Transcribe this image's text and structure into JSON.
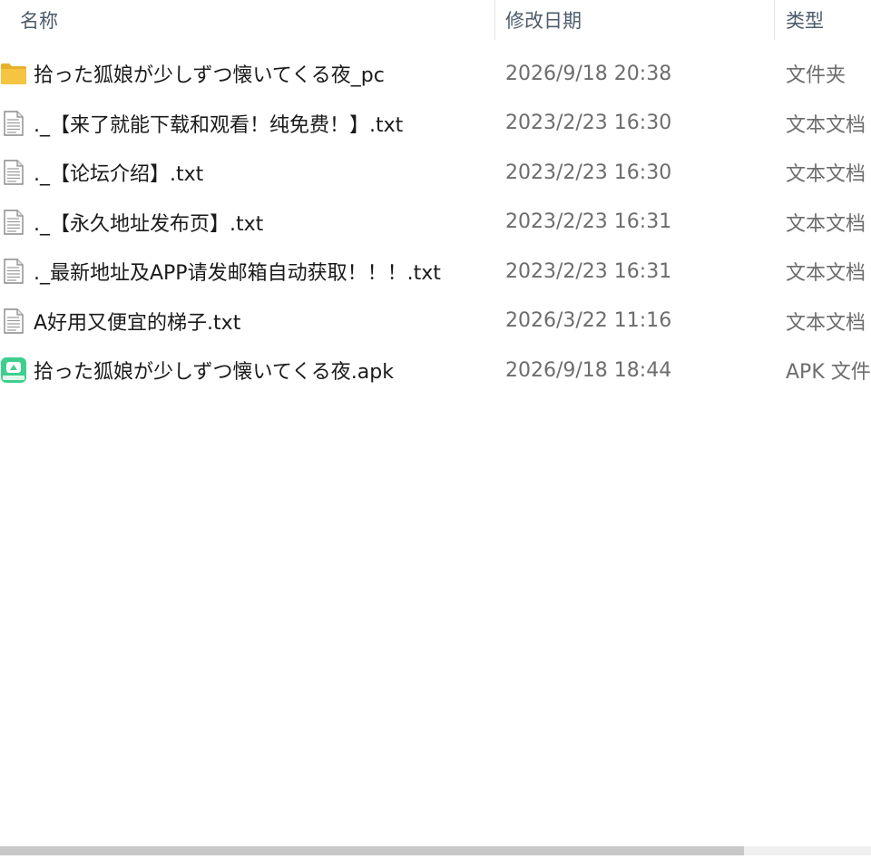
{
  "columns": {
    "name": "名称",
    "date": "修改日期",
    "type": "类型"
  },
  "files": [
    {
      "icon": "folder-icon",
      "name": "拾った狐娘が少しずつ懐いてくる夜_pc",
      "date": "2026/9/18 20:38",
      "type": "文件夹"
    },
    {
      "icon": "text-document-icon",
      "name": "._【来了就能下载和观看！纯免费！】.txt",
      "date": "2023/2/23 16:30",
      "type": "文本文档"
    },
    {
      "icon": "text-document-icon",
      "name": "._【论坛介绍】.txt",
      "date": "2023/2/23 16:30",
      "type": "文本文档"
    },
    {
      "icon": "text-document-icon",
      "name": "._【永久地址发布页】.txt",
      "date": "2023/2/23 16:31",
      "type": "文本文档"
    },
    {
      "icon": "text-document-icon",
      "name": "._最新地址及APP请发邮箱自动获取！！！.txt",
      "date": "2023/2/23 16:31",
      "type": "文本文档"
    },
    {
      "icon": "text-document-icon",
      "name": "A好用又便宜的梯子.txt",
      "date": "2026/3/22 11:16",
      "type": "文本文档"
    },
    {
      "icon": "apk-file-icon",
      "name": "拾った狐娘が少しずつ懐いてくる夜.apk",
      "date": "2026/9/18 18:44",
      "type": "APK 文件"
    }
  ],
  "colors": {
    "folder": "#f5c542",
    "apk": "#3ecf8e",
    "text": "#1a1a1a",
    "muted": "#6d6d6d"
  }
}
